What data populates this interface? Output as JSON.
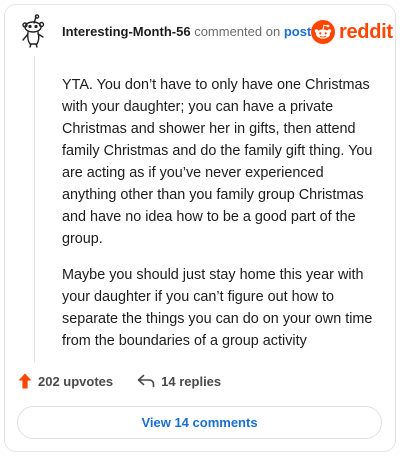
{
  "comment": {
    "username": "Interesting-Month-56",
    "action": "commented on",
    "post_link": "post",
    "brand": "reddit",
    "paragraphs": [
      "YTA. You don’t have to only have one Christmas with your daughter; you can have a private Christmas and shower her in gifts, then attend family Christmas and do the family gift thing. You are acting as if you’ve never experienced anything other than you family group Christmas and have no idea how to be a good part of the group.",
      "Maybe you should just stay home this year with your daughter if you can’t figure out how to separate the things you can do on your own time from the boundaries of a group activity"
    ]
  },
  "footer": {
    "upvotes": "202 upvotes",
    "replies": "14 replies",
    "view_comments": "View 14 comments"
  },
  "colors": {
    "brand_orange": "#ff4500",
    "link_blue": "#1a6fd1",
    "muted_text": "#6b6b6b"
  },
  "icons": {
    "avatar": "snoo-avatar-icon",
    "logo": "reddit-alien-icon",
    "upvote": "upvote-arrow-icon",
    "reply": "reply-arrow-icon"
  }
}
